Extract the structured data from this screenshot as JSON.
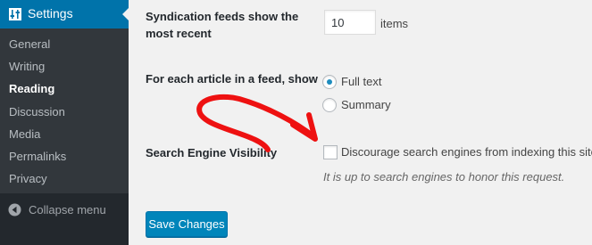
{
  "sidebar": {
    "header": {
      "label": "Settings",
      "icon": "settings-sliders-icon"
    },
    "items": [
      {
        "label": "General"
      },
      {
        "label": "Writing"
      },
      {
        "label": "Reading",
        "current": true
      },
      {
        "label": "Discussion"
      },
      {
        "label": "Media"
      },
      {
        "label": "Permalinks"
      },
      {
        "label": "Privacy"
      }
    ],
    "collapse": {
      "label": "Collapse menu",
      "icon": "collapse-left-icon"
    }
  },
  "main": {
    "syndication": {
      "label_line1": "Syndication feeds show the",
      "label_line2": "most recent",
      "value": "10",
      "unit": "items"
    },
    "feed_article": {
      "label": "For each article in a feed, show",
      "options": [
        {
          "label": "Full text",
          "checked": true
        },
        {
          "label": "Summary",
          "checked": false
        }
      ]
    },
    "search_visibility": {
      "label": "Search Engine Visibility",
      "checkbox_label": "Discourage search engines from indexing this site",
      "checked": false,
      "description": "It is up to search engines to honor this request."
    },
    "save_label": "Save Changes"
  },
  "colors": {
    "sidebar_bg": "#23282d",
    "submenu_bg": "#32373c",
    "accent": "#0073aa",
    "button": "#0085ba",
    "annotation_arrow": "#ee1111"
  },
  "annotation": {
    "icon": "red-curved-arrow-icon"
  }
}
